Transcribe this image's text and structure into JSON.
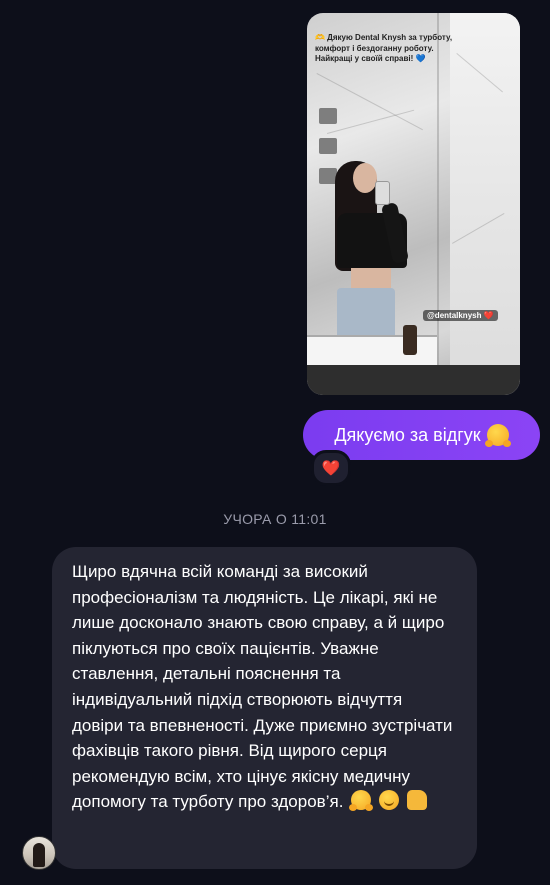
{
  "story": {
    "caption": "🫶 Дякую Dental Knysh за турботу, комфорт і бездоганну роботу. Найкращі у своїй справі! 💙",
    "mention": "@dentalknysh ❤️"
  },
  "outgoing_message": {
    "text": "Дякуємо за відгук",
    "emoji": "hugging-face-icon",
    "reaction": "❤️"
  },
  "timestamp": "УЧОРА О 11:01",
  "incoming_message": {
    "text": "Щиро вдячна всій команді за високий професіоналізм та людяність. Це лікарі, які не лише досконало знають свою справу, а й щиро піклуються про своїх пацієнтів. Уважне ставлення, детальні пояснення та індивідуальний підхід створюють відчуття довіри та впевненості. Дуже приємно зустрічати фахівців такого рівня. Від щирого серця рекомендую всім, хто цінує якісну медичну допомогу та турботу про здоров’я.",
    "emojis": [
      "hugging-face-icon",
      "smiling-face-icon",
      "thumbs-up-icon"
    ]
  },
  "colors": {
    "background": "#0d0f1a",
    "outgoing_bubble": "#7b3cf0",
    "incoming_bubble": "#242532",
    "timestamp": "#9a9bab"
  }
}
